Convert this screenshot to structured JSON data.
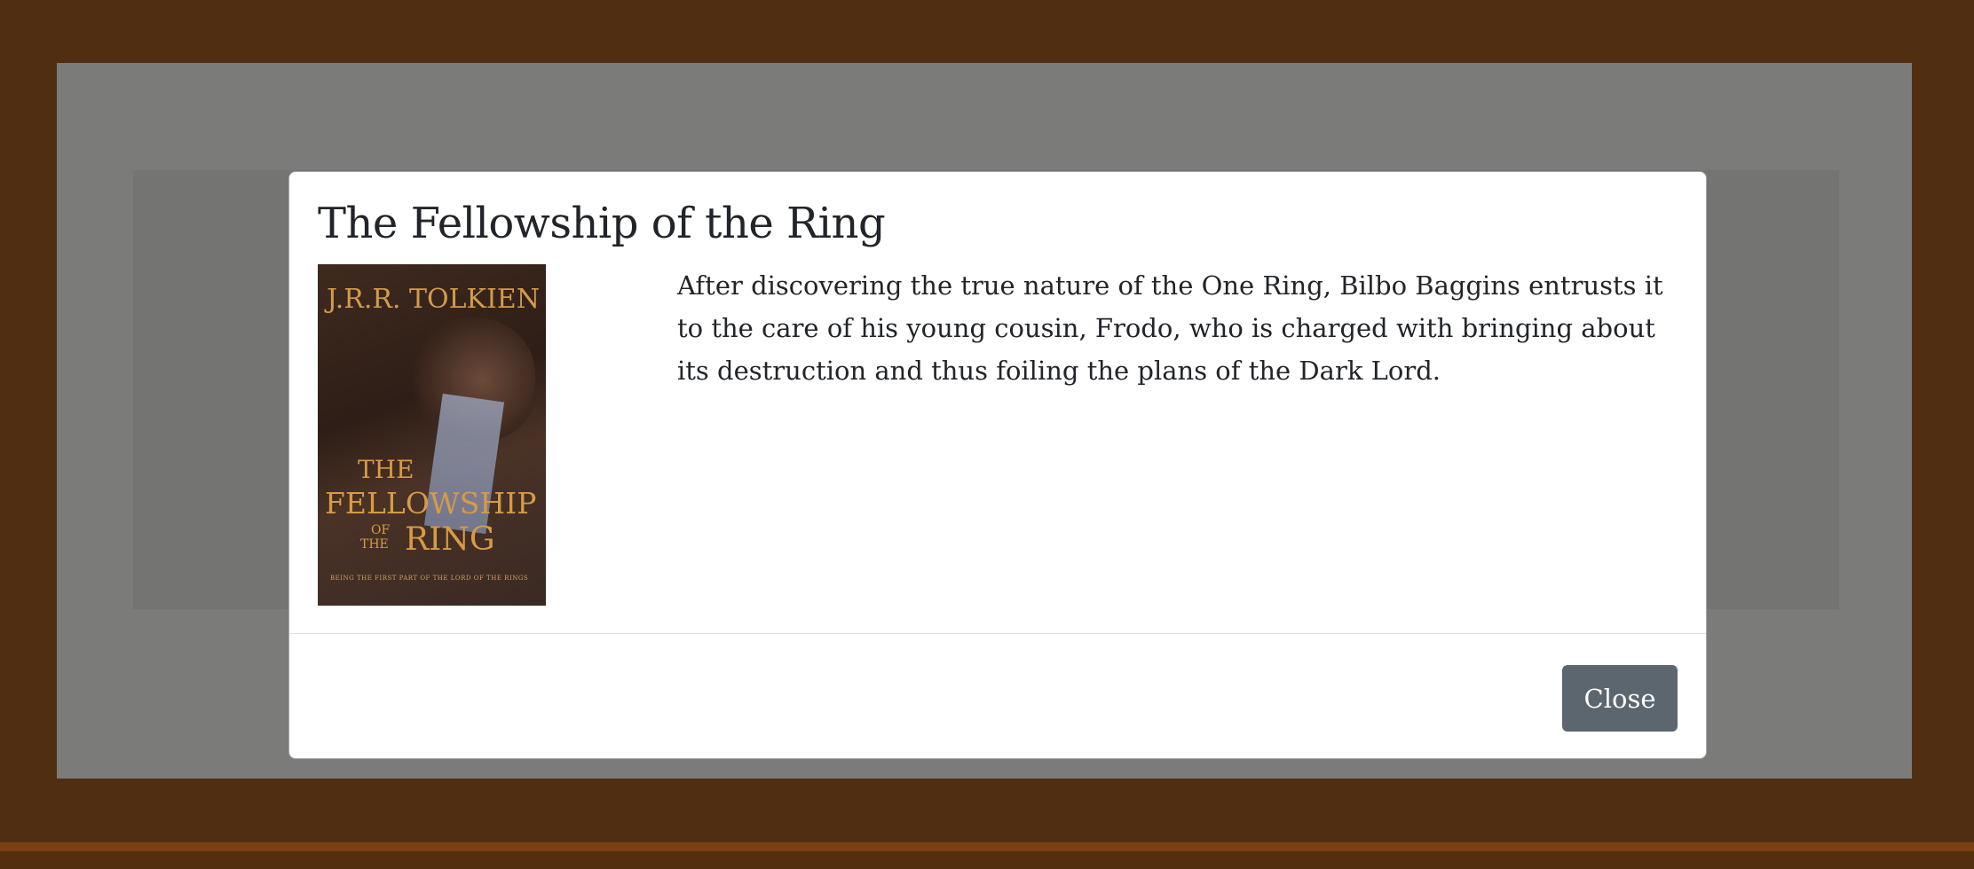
{
  "modal": {
    "title": "The Fellowship of the Ring",
    "description": "After discovering the true nature of the One Ring, Bilbo Baggins entrusts it to the care of his young cousin, Frodo, who is charged with bringing about its destruction and thus foiling the plans of the Dark Lord.",
    "close_label": "Close"
  },
  "cover": {
    "author": "J.R.R. TOLKIEN",
    "title_line1": "THE",
    "title_line2": "FELLOWSHIP",
    "title_line3": "OF",
    "title_line4": "THE",
    "title_line5": "RING",
    "tagline": "BEING THE FIRST PART OF THE LORD OF THE RINGS"
  },
  "colors": {
    "frame": "#4f2e12",
    "backdrop": "rgba(0,0,0,0.5)",
    "close_button": "#5c666e"
  }
}
